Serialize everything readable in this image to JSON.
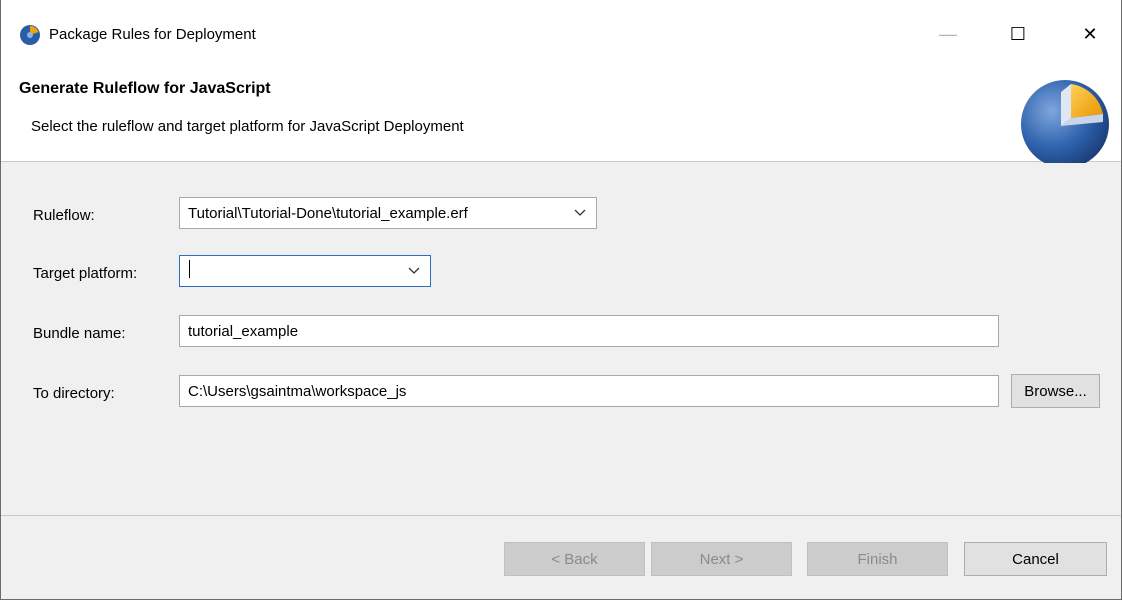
{
  "window": {
    "title": "Package Rules for Deployment",
    "controls": {
      "minimize": "—",
      "maximize": "☐",
      "close": "✕"
    }
  },
  "banner": {
    "heading": "Generate Ruleflow for JavaScript",
    "description": "Select the ruleflow and target platform for JavaScript Deployment"
  },
  "form": {
    "ruleflow": {
      "label": "Ruleflow:",
      "value": "Tutorial\\Tutorial-Done\\tutorial_example.erf"
    },
    "target_platform": {
      "label": "Target platform:",
      "value": ""
    },
    "bundle_name": {
      "label": "Bundle name:",
      "value": "tutorial_example"
    },
    "to_directory": {
      "label": "To directory:",
      "value": "C:\\Users\\gsaintma\\workspace_js",
      "browse_label": "Browse..."
    }
  },
  "buttons": {
    "back": "< Back",
    "next": "Next >",
    "finish": "Finish",
    "cancel": "Cancel"
  },
  "colors": {
    "focus_border": "#2f6ebd",
    "logo_blue": "#2a5da8",
    "logo_orange": "#f0a30a"
  }
}
